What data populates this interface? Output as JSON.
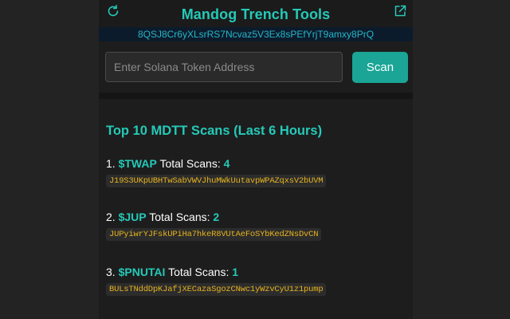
{
  "app": {
    "title": "Mandog Trench Tools",
    "wallet_address": "8QSJ8Cr6yXLsrRS7Ncvaz5V3Ex8sPEfYrjT9amxy8PrQ"
  },
  "search": {
    "placeholder": "Enter Solana Token Address",
    "value": "",
    "button_label": "Scan"
  },
  "icons": {
    "refresh": "refresh-icon",
    "external": "external-link-icon"
  },
  "colors": {
    "accent": "#25c9b8",
    "address": "#e6b31e",
    "button": "#1aa596"
  },
  "top_scans": {
    "title": "Top 10 MDTT Scans (Last 6 Hours)",
    "total_label": "Total Scans:",
    "items": [
      {
        "rank": "1.",
        "ticker": "$TWAP",
        "count": "4",
        "address": "J19S3UKpUBHTwSabVWVJhuMWkUutavpWPAZqxsV2bUVM"
      },
      {
        "rank": "2.",
        "ticker": "$JUP",
        "count": "2",
        "address": "JUPyiwrYJFskUPiHa7hkeR8VUtAeFoSYbKedZNsDvCN"
      },
      {
        "rank": "3.",
        "ticker": "$PNUTAI",
        "count": "1",
        "address": "BULsTNddDpKJafjXECazaSgozCNwc1yWzvCyU1z1pump"
      }
    ]
  }
}
